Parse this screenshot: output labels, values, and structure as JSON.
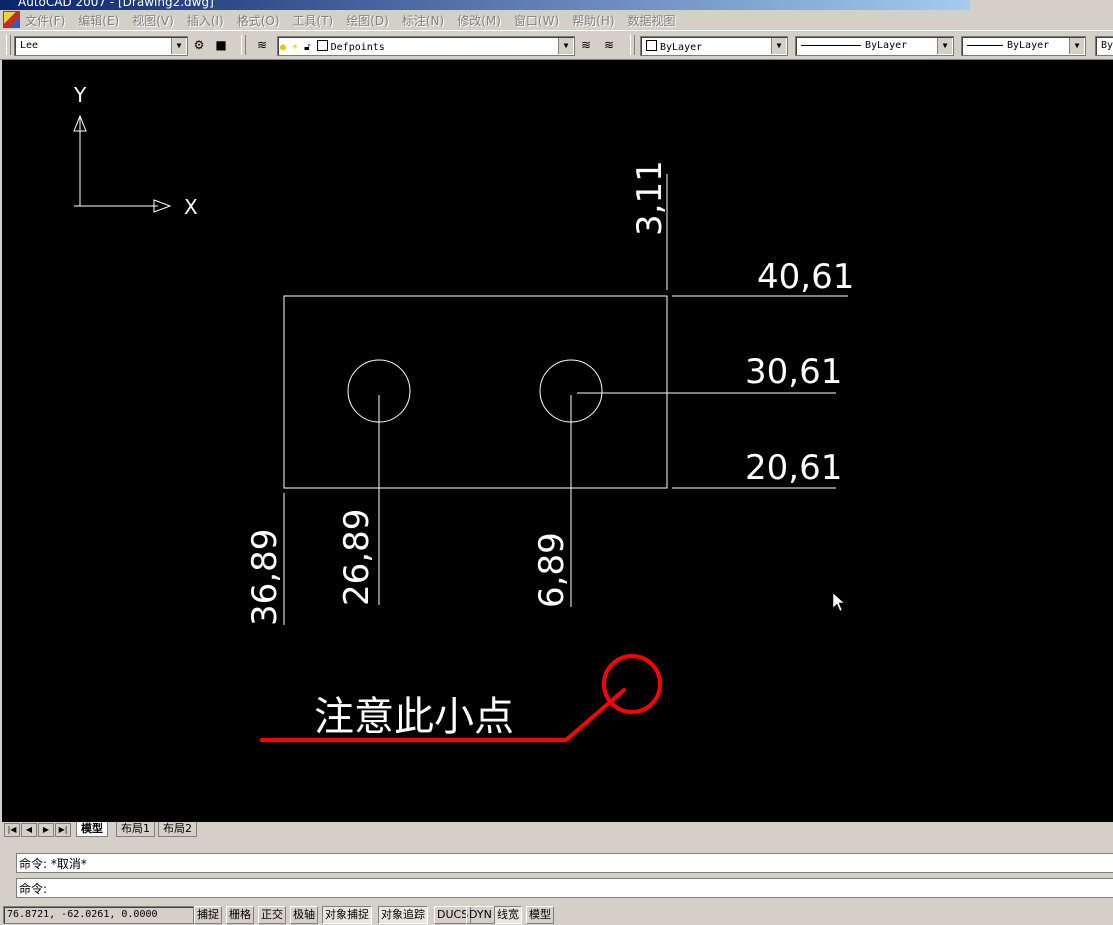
{
  "window": {
    "title": "AutoCAD 2007 - [Drawing2.dwg]"
  },
  "menu": [
    "文件(F)",
    "编辑(E)",
    "视图(V)",
    "插入(I)",
    "格式(O)",
    "工具(T)",
    "绘图(D)",
    "标注(N)",
    "修改(M)",
    "窗口(W)",
    "帮助(H)",
    "数据视图"
  ],
  "toolbar": {
    "workspace": "Lee",
    "layer": "Defpoints",
    "color": "ByLayer",
    "linetype": "ByLayer",
    "lineweight": "ByLayer",
    "plotstyle": "By"
  },
  "ucs": {
    "y_label": "Y",
    "x_label": "X"
  },
  "dimensions": {
    "top": "3,11",
    "right_top": "40,61",
    "right_mid": "30,61",
    "right_bottom": "20,61",
    "left_outer": "36,89",
    "left_hole": "26,89",
    "right_hole": "6,89"
  },
  "annotation": {
    "text": "注意此小点",
    "color": "#ff0000"
  },
  "tabs": [
    "模型",
    "布局1",
    "布局2"
  ],
  "active_tab": "模型",
  "command": {
    "history": "命令: *取消*",
    "prompt": "命令:"
  },
  "status": {
    "coords": "76.8721,  -62.0261, 0.0000",
    "buttons": [
      "捕捉",
      "栅格",
      "正交",
      "极轴",
      "对象捕捉",
      "对象追踪",
      "DUCS",
      "DYN",
      "线宽",
      "模型"
    ]
  },
  "colors": {
    "canvas": "#000000",
    "chrome": "#d4d0c8",
    "draw": "#ffffff"
  }
}
